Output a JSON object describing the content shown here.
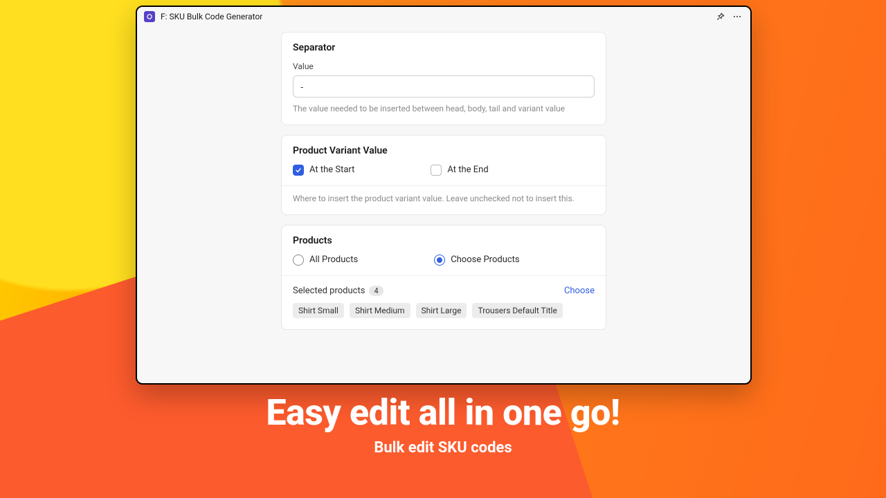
{
  "titlebar": {
    "title": "F: SKU Bulk Code Generator"
  },
  "separator": {
    "heading": "Separator",
    "field_label": "Value",
    "value": "-",
    "help": "The value needed to be inserted between head, body, tail and variant value"
  },
  "variant": {
    "heading": "Product Variant Value",
    "start_label": "At the Start",
    "end_label": "At the End",
    "start_checked": true,
    "end_checked": false,
    "help": "Where to insert the product variant value. Leave unchecked not to insert this."
  },
  "products": {
    "heading": "Products",
    "all_label": "All Products",
    "choose_label": "Choose Products",
    "mode": "choose",
    "selected_label": "Selected products",
    "count": "4",
    "choose_link": "Choose",
    "tags": [
      "Shirt Small",
      "Shirt Medium",
      "Shirt Large",
      "Trousers Default Title"
    ]
  },
  "hero": {
    "headline": "Easy edit all in one go!",
    "subhead": "Bulk edit SKU codes"
  }
}
